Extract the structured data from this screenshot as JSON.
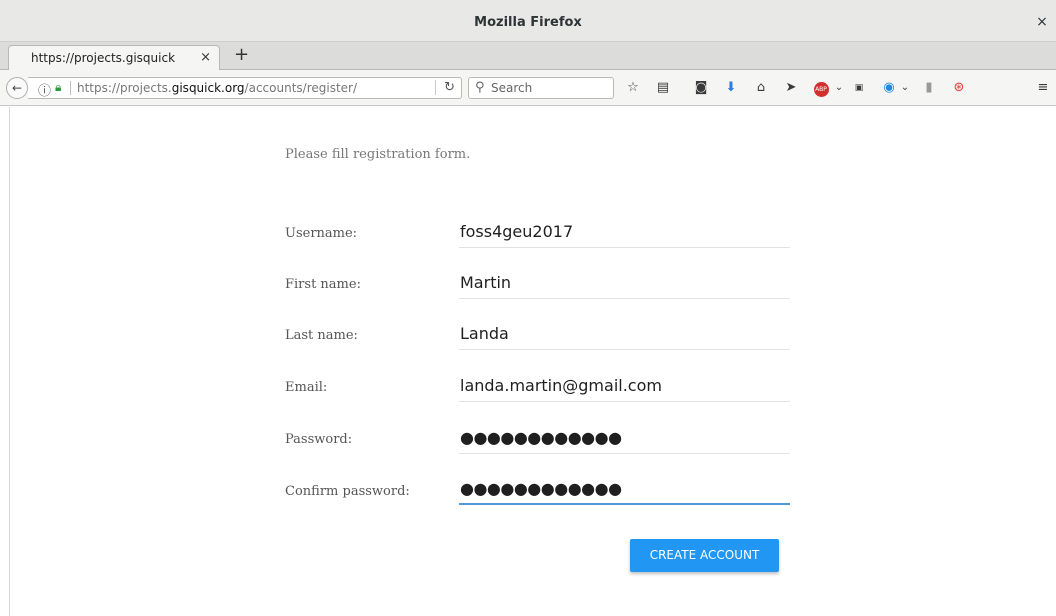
{
  "window": {
    "title": "Mozilla Firefox",
    "close_glyph": "×"
  },
  "tabs": [
    {
      "label": "https://projects.gisquick",
      "close_glyph": "×"
    }
  ],
  "new_tab_glyph": "+",
  "navbar": {
    "url_prefix": "https://projects.",
    "url_domain": "gisquick.org",
    "url_path": "/accounts/register/",
    "search_placeholder": "Search",
    "toolbar_icons": [
      "bookmark-star-icon",
      "reading-list-icon",
      "pocket-icon",
      "downloads-icon",
      "home-icon",
      "send-icon",
      "adblock-plus-icon",
      "youtube-icon",
      "extension-icon",
      "info-icon",
      "help-icon",
      "menu-icon"
    ]
  },
  "form": {
    "intro": "Please fill registration form.",
    "fields": [
      {
        "label": "Username:",
        "value": "foss4geu2017"
      },
      {
        "label": "First name:",
        "value": "Martin"
      },
      {
        "label": "Last name:",
        "value": "Landa"
      },
      {
        "label": "Email:",
        "value": "landa.martin@gmail.com"
      },
      {
        "label": "Password:",
        "value": "●●●●●●●●●●●●"
      },
      {
        "label": "Confirm password:",
        "value": "●●●●●●●●●●●●"
      }
    ],
    "submit_label": "CREATE ACCOUNT",
    "accent_color": "#2196f3"
  }
}
